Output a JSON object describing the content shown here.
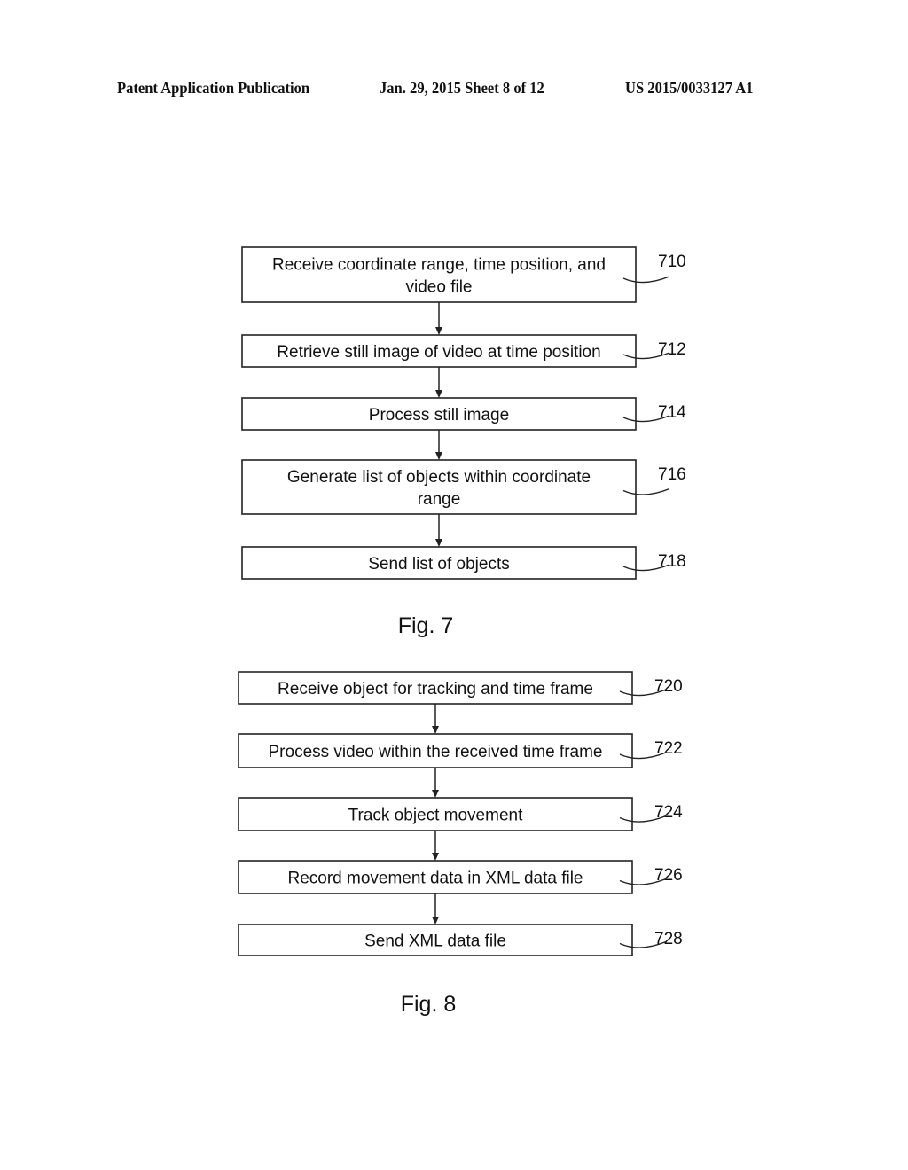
{
  "header": {
    "publication": "Patent Application Publication",
    "date_sheet": "Jan. 29, 2015  Sheet 8 of 12",
    "patent_number": "US 2015/0033127 A1"
  },
  "figures": [
    {
      "caption": "Fig. 7",
      "steps": [
        {
          "ref": "710",
          "lines": [
            "Receive coordinate range, time position, and",
            "video file"
          ]
        },
        {
          "ref": "712",
          "lines": [
            "Retrieve still image of video at time position"
          ]
        },
        {
          "ref": "714",
          "lines": [
            "Process still image"
          ]
        },
        {
          "ref": "716",
          "lines": [
            "Generate list of objects within coordinate",
            "range"
          ]
        },
        {
          "ref": "718",
          "lines": [
            "Send list of objects"
          ]
        }
      ]
    },
    {
      "caption": "Fig. 8",
      "steps": [
        {
          "ref": "720",
          "lines": [
            "Receive object for tracking and time frame"
          ]
        },
        {
          "ref": "722",
          "lines": [
            "Process video within the received time frame"
          ]
        },
        {
          "ref": "724",
          "lines": [
            "Track object movement"
          ]
        },
        {
          "ref": "726",
          "lines": [
            "Record movement data in XML data file"
          ]
        },
        {
          "ref": "728",
          "lines": [
            "Send XML data file"
          ]
        }
      ]
    }
  ]
}
